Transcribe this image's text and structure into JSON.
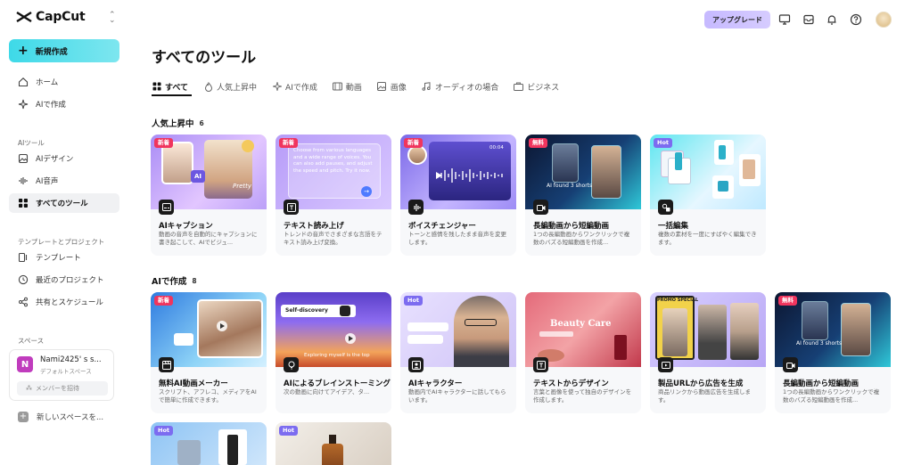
{
  "app": {
    "name": "CapCut"
  },
  "sidebar": {
    "new_button": "新規作成",
    "items": [
      {
        "label": "ホーム",
        "icon": "home-icon"
      },
      {
        "label": "AIで作成",
        "icon": "sparkle-icon"
      }
    ],
    "ai_tools_label": "AIツール",
    "ai_items": [
      {
        "label": "AIデザイン",
        "icon": "image-icon"
      },
      {
        "label": "AI音声",
        "icon": "waveform-icon"
      },
      {
        "label": "すべてのツール",
        "icon": "grid-icon",
        "active": true
      }
    ],
    "templates_label": "テンプレートとプロジェクト",
    "template_items": [
      {
        "label": "テンプレート",
        "icon": "template-icon"
      },
      {
        "label": "最近のプロジェクト",
        "icon": "clock-icon"
      },
      {
        "label": "共有とスケジュール",
        "icon": "share-icon"
      }
    ],
    "space_label": "スペース",
    "space": {
      "initial": "N",
      "name": "Nami2425' s s...",
      "subtitle": "デフォルトスペース",
      "invite": "メンバーを招待"
    },
    "new_space": "新しいスペースを..."
  },
  "topbar": {
    "upgrade": "アップグレード"
  },
  "main": {
    "title": "すべてのツール",
    "tabs": [
      {
        "label": "すべて",
        "icon": "grid-icon",
        "active": true
      },
      {
        "label": "人気上昇中",
        "icon": "flame-icon"
      },
      {
        "label": "AIで作成",
        "icon": "sparkle-icon"
      },
      {
        "label": "動画",
        "icon": "film-icon"
      },
      {
        "label": "画像",
        "icon": "image-icon"
      },
      {
        "label": "オーディオの場合",
        "icon": "music-icon"
      },
      {
        "label": "ビジネス",
        "icon": "briefcase-icon"
      }
    ],
    "sections": [
      {
        "title": "人気上昇中",
        "count": "6",
        "cards": [
          {
            "badge": "新着",
            "title": "AIキャプション",
            "desc": "動画の音声を自動的にキャプションに書き起こして、AIでビジュ..."
          },
          {
            "badge": "新着",
            "title": "テキスト読み上げ",
            "desc": "トレンドの音声でさまざまな言語をテキスト読み上げ変換。",
            "thumb_text": "Choose from various languages and a wide range of voices. You can also add pauses, and adjust the speed and pitch. Try it now."
          },
          {
            "badge": "新着",
            "title": "ボイスチェンジャー",
            "desc": "トーンと感情を残したまま音声を変更します。",
            "thumb_text": "00:04"
          },
          {
            "badge": "無料",
            "title": "長編動画から短編動画",
            "desc": "1つの長編動画からワンクリックで複数のバズる短編動画を作成...",
            "thumb_text": "AI found 3 shorts"
          },
          {
            "badge": "Hot",
            "title": "一括編集",
            "desc": "複数の素材を一度にすばやく編集できます。"
          }
        ]
      },
      {
        "title": "AIで作成",
        "count": "8",
        "cards": [
          {
            "badge": "新着",
            "title": "無料AI動画メーカー",
            "desc": "スクリプト、アフレコ、メディアをAIで簡単に作成できます。"
          },
          {
            "badge": "",
            "title": "AIによるブレインストーミング",
            "desc": "次の動画に向けてアイデア、タ...",
            "thumb_text": "Self-discovery",
            "thumb_caption": "Exploring myself is the top"
          },
          {
            "badge": "Hot",
            "title": "AIキャラクター",
            "desc": "動画内でAIキャラクターに話してもらいます。"
          },
          {
            "badge": "",
            "title": "テキストからデザイン",
            "desc": "言葉と画像を使って独自のデザインを作成します。",
            "thumb_text": "Beauty Care"
          },
          {
            "badge": "",
            "title": "製品URLから広告を生成",
            "desc": "商品リンクから動画広告を生成します。",
            "thumb_text": "PROMO SPECIAL"
          },
          {
            "badge": "無料",
            "title": "長編動画から短編動画",
            "desc": "1つの長編動画からワンクリックで複数のバズる短編動画を作成...",
            "thumb_text": "AI found 3 shorts"
          }
        ]
      },
      {
        "cards": [
          {
            "badge": "Hot"
          },
          {
            "badge": "Hot"
          }
        ]
      }
    ]
  }
}
